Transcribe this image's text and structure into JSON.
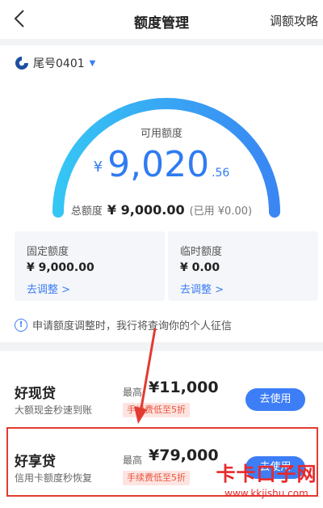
{
  "header": {
    "title": "额度管理",
    "right_link": "调额攻略"
  },
  "account": {
    "label": "尾号0401"
  },
  "available": {
    "label": "可用额度",
    "currency": "¥",
    "integer": "9,020",
    "decimal": ".56"
  },
  "total": {
    "label": "总额度",
    "value": "¥ 9,000.00",
    "used": "(已用 ¥0.00)"
  },
  "boxes": [
    {
      "label": "固定额度",
      "value": "¥ 9,000.00",
      "action": "去调整 >"
    },
    {
      "label": "临时额度",
      "value": "¥ 0.00",
      "action": "去调整 >"
    }
  ],
  "notice": "申请额度调整时，我行将查询你的个人征信",
  "loans": [
    {
      "name": "好现贷",
      "desc": "大额现金秒速到账",
      "max_label": "最高",
      "amount": "¥11,000",
      "fee": "手续费低至5折",
      "button": "去使用"
    },
    {
      "name": "好享贷",
      "desc": "信用卡额度秒恢复",
      "max_label": "最高",
      "amount": "¥79,000",
      "fee": "手续费低至5折",
      "button": "去使用"
    }
  ],
  "watermark": {
    "line1": "卡卡口子网",
    "line2": "www.kkjishu.com"
  },
  "colors": {
    "accent": "#3d7ef6",
    "highlight": "#e23b31",
    "fee_text": "#e8553e"
  }
}
